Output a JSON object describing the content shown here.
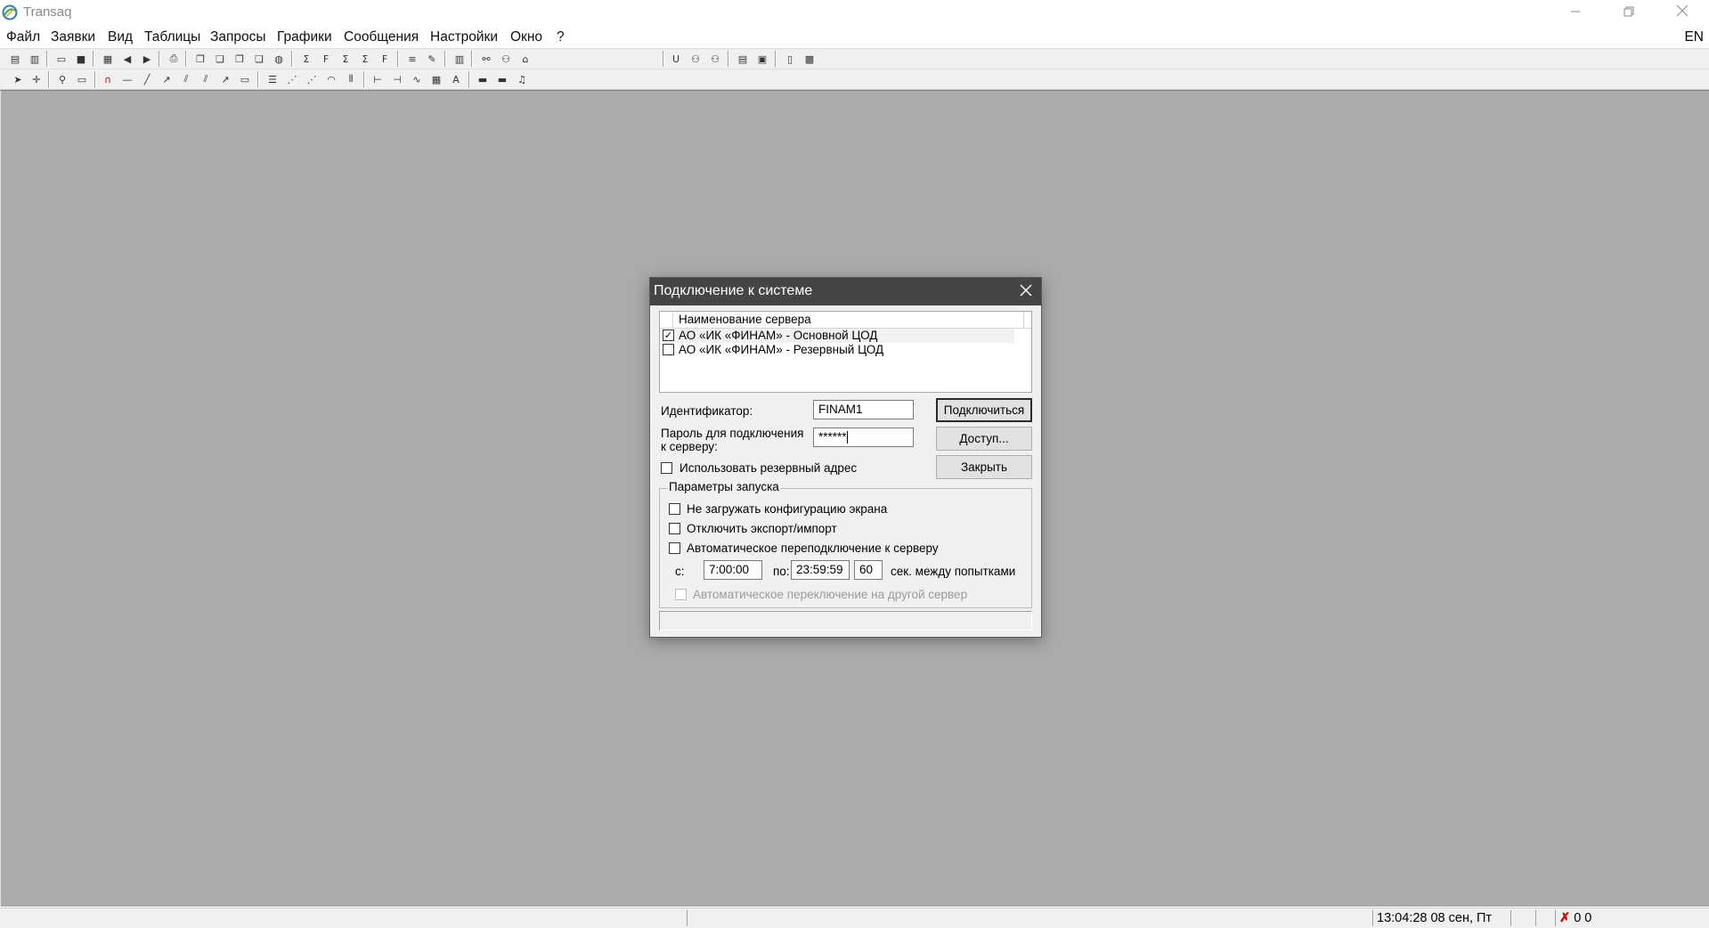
{
  "app": {
    "title": "Transaq",
    "icon": "transaq-logo-icon"
  },
  "window_controls": [
    "minimize-icon",
    "restore-icon",
    "close-icon"
  ],
  "menu": {
    "items": [
      "Файл",
      "Заявки",
      "Вид",
      "Таблицы",
      "Запросы",
      "Графики",
      "Сообщения",
      "Настройки",
      "Окно",
      "?"
    ],
    "language": "EN"
  },
  "colors": {
    "workspace": "#ababab",
    "dialog_title_bar": "#454545",
    "dialog_body": "#f0f0f0"
  },
  "dialog": {
    "title": "Подключение к системе",
    "server_list": {
      "column_header": "Наименование сервера",
      "rows": [
        {
          "checked": true,
          "label": "АО «ИК «ФИНАМ» - Основной ЦОД"
        },
        {
          "checked": false,
          "label": "АО «ИК «ФИНАМ» - Резервный ЦОД"
        }
      ]
    },
    "identifier_label": "Идентификатор:",
    "identifier_value": "FINAM1",
    "password_label_line1": "Пароль для подключения",
    "password_label_line2": "к серверу:",
    "password_value": "******",
    "use_backup_label": "Использовать резервный адрес",
    "buttons": {
      "connect": "Подключиться",
      "access": "Доступ...",
      "close": "Закрыть"
    },
    "launch_params": {
      "title": "Параметры запуска",
      "no_screen_config": "Не загружать конфигурацию экрана",
      "disable_export_import": "Отключить экспорт/импорт",
      "auto_reconnect": "Автоматическое переподключение к серверу",
      "from_label": "с:",
      "from_value": "7:00:00",
      "to_label": "по:",
      "to_value": "23:59:59",
      "interval_value": "60",
      "interval_suffix": "сек. между попытками",
      "auto_switch_server": "Автоматическое переключение на другой сервер"
    }
  },
  "statusbar": {
    "datetime": "13:04:28  08 сен, Пт",
    "counters": "0 0"
  }
}
